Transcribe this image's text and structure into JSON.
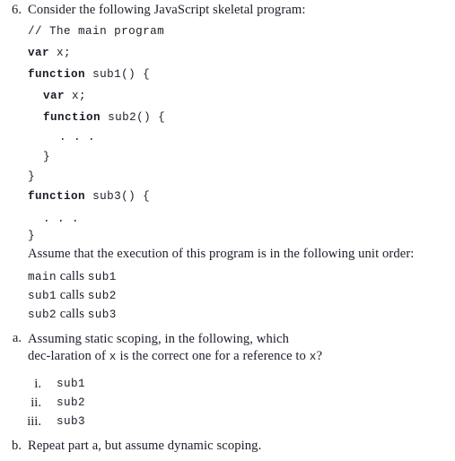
{
  "document": {
    "background_color": "#ffffff",
    "text_color": "#1b1b28"
  },
  "question": {
    "number": "6.",
    "stem": "Consider the following JavaScript skeletal program:"
  },
  "code_block": {
    "lines": [
      {
        "indent": 0,
        "text": "// The main program",
        "bold_prefix": ""
      },
      {
        "indent": 0,
        "text": "var x;",
        "bold_prefix": "var"
      },
      {
        "indent": 0,
        "text": "function sub1() {",
        "bold_prefix": "function"
      },
      {
        "indent": 1,
        "text": "var x;",
        "bold_prefix": "var"
      },
      {
        "indent": 1,
        "text": "function sub2() {",
        "bold_prefix": "function"
      },
      {
        "indent": 2,
        "text": ". . .",
        "bold_prefix": ""
      },
      {
        "indent": 1,
        "text": "}",
        "bold_prefix": ""
      },
      {
        "indent": 0,
        "text": "}",
        "bold_prefix": ""
      },
      {
        "indent": 0,
        "text": "function sub3() {",
        "bold_prefix": "function"
      },
      {
        "indent": 1,
        "text": ". . .",
        "bold_prefix": ""
      },
      {
        "indent": 0,
        "text": "}",
        "bold_prefix": ""
      }
    ],
    "line_0_comment": "// The main program",
    "line_1_kw": "var",
    "line_1_rest": " x;",
    "line_2_kw": "function",
    "line_2_rest": " sub1() {",
    "line_3_kw": "var",
    "line_3_rest": " x;",
    "line_4_kw": "function",
    "line_4_rest": " sub2() {",
    "line_5_ellipsis": ". . .",
    "line_6_brace": "}",
    "line_7_brace": "}",
    "line_8_kw": "function",
    "line_8_rest": " sub3() {",
    "line_9_ellipsis": ". . .",
    "line_10_brace": "}"
  },
  "assume_line": "Assume that the execution of this program is in the following unit order:",
  "unit_order": [
    {
      "caller": "main",
      "verb": "calls",
      "callee": "sub1"
    },
    {
      "caller": "sub1",
      "verb": "calls",
      "callee": "sub2"
    },
    {
      "caller": "sub2",
      "verb": "calls",
      "callee": "sub3"
    }
  ],
  "part_a": {
    "marker": "a.",
    "text_before_x1": "Assuming static scoping, in the following, which dec‑laration of ",
    "x1": "x",
    "text_middle": " is the correct one for a reference to ",
    "x2": "x",
    "text_after": "?",
    "full_text": "Assuming static scoping, in the following, which declaration of x is the correct one for a reference to x?",
    "choices": [
      {
        "marker": "i.",
        "label": "sub1"
      },
      {
        "marker": "ii.",
        "label": "sub2"
      },
      {
        "marker": "iii.",
        "label": "sub3"
      }
    ]
  },
  "part_b": {
    "marker": "b.",
    "text": "Repeat part a, but assume dynamic scoping."
  }
}
